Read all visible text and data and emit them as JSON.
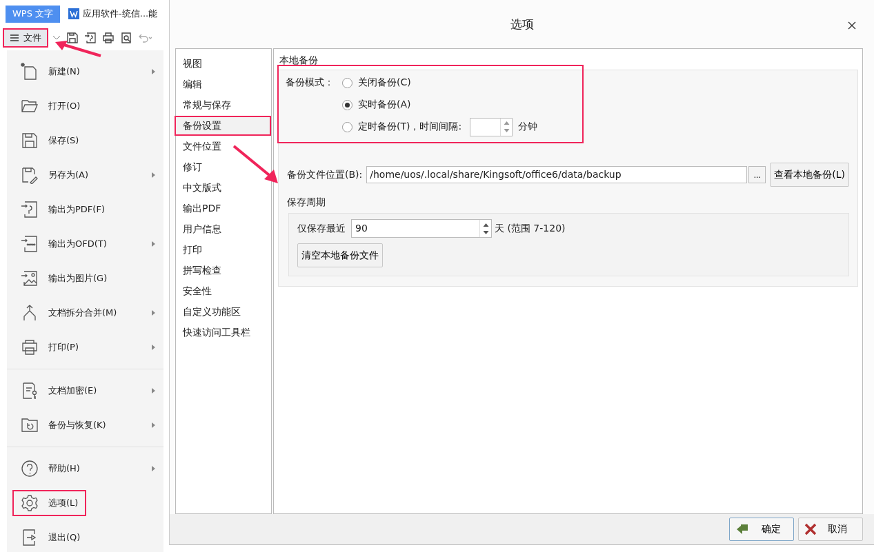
{
  "app_tabs": [
    {
      "label": "WPS 文字",
      "kind": "brand"
    },
    {
      "label": "应用软件-统信...能",
      "kind": "document"
    }
  ],
  "toolbar": {
    "file_menu_label": "文件",
    "annotated": true
  },
  "file_menu": {
    "groups": [
      [
        {
          "label": "新建(N)",
          "submenu": true,
          "annotated": false
        },
        {
          "label": "打开(O)",
          "submenu": false,
          "annotated": false
        },
        {
          "label": "保存(S)",
          "submenu": false,
          "annotated": false
        },
        {
          "label": "另存为(A)",
          "submenu": true,
          "annotated": false
        },
        {
          "label": "输出为PDF(F)",
          "submenu": false,
          "annotated": false
        },
        {
          "label": "输出为OFD(T)",
          "submenu": true,
          "annotated": false
        },
        {
          "label": "输出为图片(G)",
          "submenu": false,
          "annotated": false
        },
        {
          "label": "文档拆分合并(M)",
          "submenu": true,
          "annotated": false
        },
        {
          "label": "打印(P)",
          "submenu": true,
          "annotated": false
        }
      ],
      [
        {
          "label": "文档加密(E)",
          "submenu": true,
          "annotated": false
        },
        {
          "label": "备份与恢复(K)",
          "submenu": true,
          "annotated": false
        }
      ],
      [
        {
          "label": "帮助(H)",
          "submenu": true,
          "annotated": false
        },
        {
          "label": "选项(L)",
          "submenu": false,
          "annotated": true
        },
        {
          "label": "退出(Q)",
          "submenu": false,
          "annotated": false
        }
      ]
    ]
  },
  "dialog": {
    "title": "选项",
    "nav": [
      {
        "label": "视图",
        "selected": false,
        "annotated": false
      },
      {
        "label": "编辑",
        "selected": false,
        "annotated": false
      },
      {
        "label": "常规与保存",
        "selected": false,
        "annotated": false
      },
      {
        "label": "备份设置",
        "selected": true,
        "annotated": true
      },
      {
        "label": "文件位置",
        "selected": false,
        "annotated": false
      },
      {
        "label": "修订",
        "selected": false,
        "annotated": false
      },
      {
        "label": "中文版式",
        "selected": false,
        "annotated": false
      },
      {
        "label": "输出PDF",
        "selected": false,
        "annotated": false
      },
      {
        "label": "用户信息",
        "selected": false,
        "annotated": false
      },
      {
        "label": "打印",
        "selected": false,
        "annotated": false
      },
      {
        "label": "拼写检查",
        "selected": false,
        "annotated": false
      },
      {
        "label": "安全性",
        "selected": false,
        "annotated": false
      },
      {
        "label": "自定义功能区",
        "selected": false,
        "annotated": false
      },
      {
        "label": "快速访问工具栏",
        "selected": false,
        "annotated": false
      }
    ],
    "section_title": "本地备份",
    "backup_mode": {
      "label": "备份模式：",
      "annotated": true,
      "options": [
        {
          "label": "关闭备份(C)",
          "selected": false
        },
        {
          "label": "实时备份(A)",
          "selected": true
        },
        {
          "label": "定时备份(T)，时间间隔:",
          "selected": false
        }
      ],
      "interval_unit": "分钟"
    },
    "location": {
      "label": "备份文件位置(B):",
      "value": "/home/uos/.local/share/Kingsoft/office6/data/backup",
      "browse": "...",
      "view_button": "查看本地备份(L)"
    },
    "retention": {
      "title": "保存周期",
      "label": "仅保存最近",
      "value": "90",
      "suffix": "天 (范围 7-120)",
      "clear_button": "清空本地备份文件"
    },
    "buttons": [
      {
        "label": "确定",
        "kind": "ok"
      },
      {
        "label": "取消",
        "kind": "cancel"
      }
    ]
  }
}
